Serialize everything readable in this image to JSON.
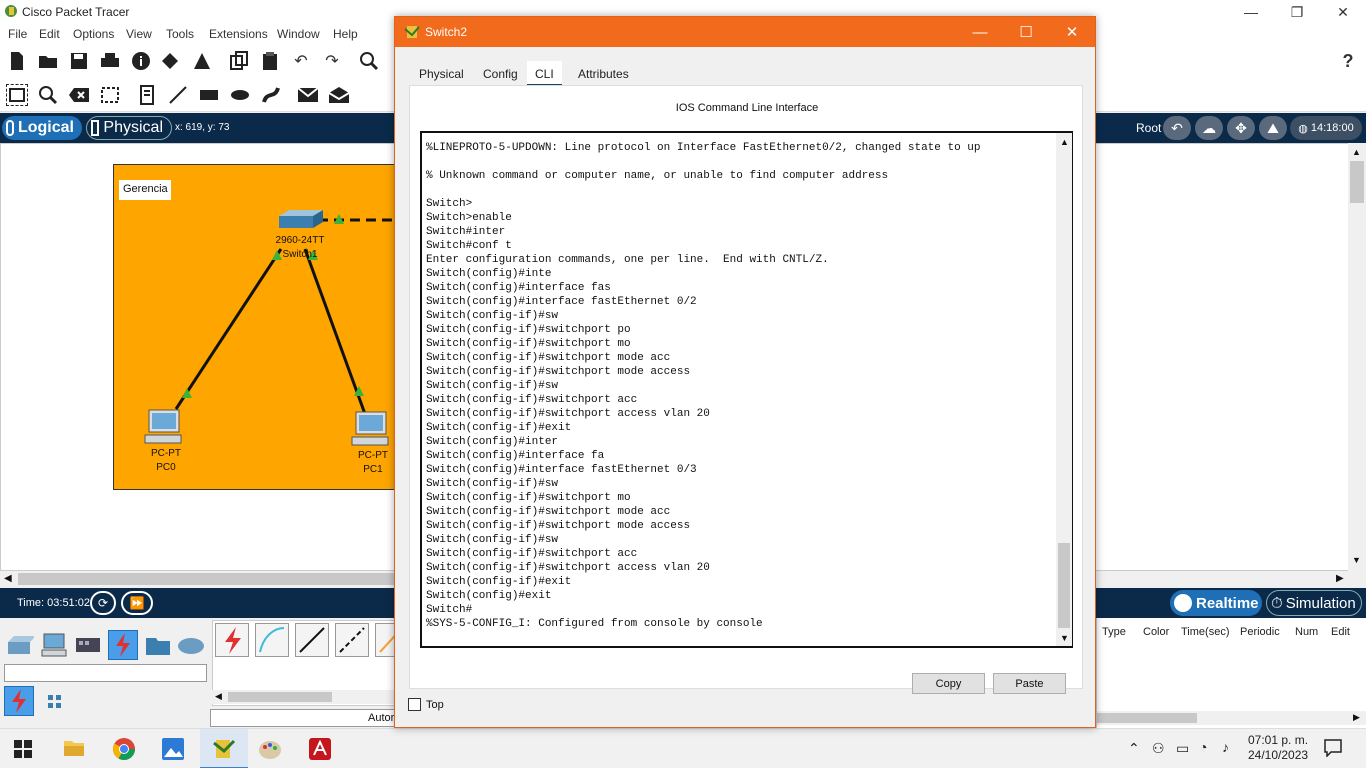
{
  "app": {
    "title": "Cisco Packet Tracer",
    "menu": [
      "File",
      "Edit",
      "Options",
      "View",
      "Tools",
      "Extensions",
      "Window",
      "Help"
    ],
    "help_glyph": "?"
  },
  "nav": {
    "logical_label": "Logical",
    "physical_label": "Physical",
    "coordinates": "x: 619, y: 73",
    "root_label": "Root",
    "clock": "14:18:00"
  },
  "workspace": {
    "cluster_label": "Gerencia",
    "switch": {
      "model": "2960-24TT",
      "name": "Switch1"
    },
    "pcs": [
      {
        "model": "PC-PT",
        "name": "PC0"
      },
      {
        "model": "PC-PT",
        "name": "PC1"
      }
    ]
  },
  "bottom": {
    "time": "Time: 03:51:02",
    "realtime_label": "Realtime",
    "simulation_label": "Simulation",
    "pdu_columns": [
      "Type",
      "Color",
      "Time(sec)",
      "Periodic",
      "Num",
      "Edit"
    ],
    "cable_auto_label": "Autor"
  },
  "taskbar": {
    "time": "07:01 p. m.",
    "date": "24/10/2023"
  },
  "dialog": {
    "title": "Switch2",
    "tabs": [
      "Physical",
      "Config",
      "CLI",
      "Attributes"
    ],
    "active_tab": "CLI",
    "heading": "IOS Command Line Interface",
    "terminal_lines": [
      "%LINEPROTO-5-UPDOWN: Line protocol on Interface FastEthernet0/2, changed state to up",
      "",
      "% Unknown command or computer name, or unable to find computer address",
      "",
      "Switch>",
      "Switch>enable",
      "Switch#inter",
      "Switch#conf t",
      "Enter configuration commands, one per line.  End with CNTL/Z.",
      "Switch(config)#inte",
      "Switch(config)#interface fas",
      "Switch(config)#interface fastEthernet 0/2",
      "Switch(config-if)#sw",
      "Switch(config-if)#switchport po",
      "Switch(config-if)#switchport mo",
      "Switch(config-if)#switchport mode acc",
      "Switch(config-if)#switchport mode access",
      "Switch(config-if)#sw",
      "Switch(config-if)#switchport acc",
      "Switch(config-if)#switchport access vlan 20",
      "Switch(config-if)#exit",
      "Switch(config)#inter",
      "Switch(config)#interface fa",
      "Switch(config)#interface fastEthernet 0/3",
      "Switch(config-if)#sw",
      "Switch(config-if)#switchport mo",
      "Switch(config-if)#switchport mode acc",
      "Switch(config-if)#switchport mode access",
      "Switch(config-if)#sw",
      "Switch(config-if)#switchport acc",
      "Switch(config-if)#switchport access vlan 20",
      "Switch(config-if)#exit",
      "Switch(config)#exit",
      "Switch#",
      "%SYS-5-CONFIG_I: Configured from console by console"
    ],
    "copy_label": "Copy",
    "paste_label": "Paste",
    "top_label": "Top"
  },
  "colors": {
    "dialog_title": "#f26a1b",
    "navbar": "#0b2a4a",
    "cluster": "#ffa500",
    "realtime": "#1e6fb5"
  }
}
